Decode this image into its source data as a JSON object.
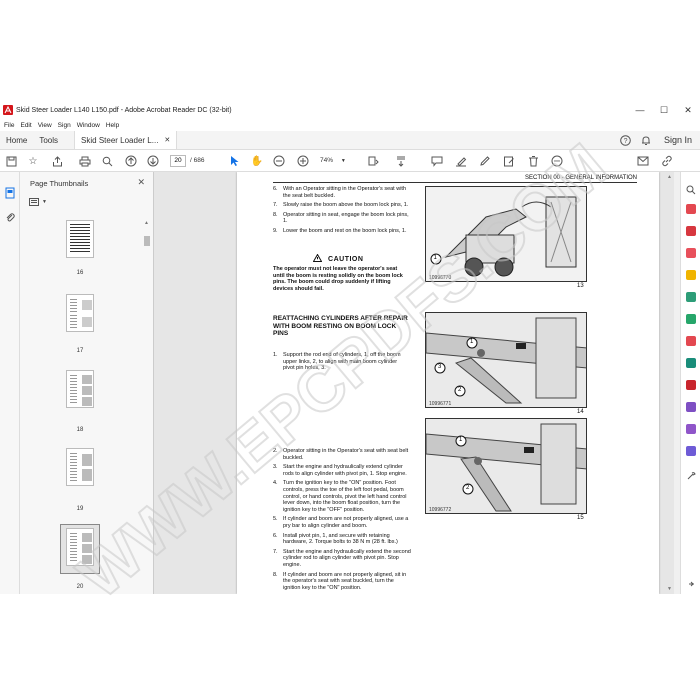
{
  "window": {
    "title": "Skid Steer Loader L140 L150.pdf - Adobe Acrobat Reader DC (32-bit)"
  },
  "menu": [
    "File",
    "Edit",
    "View",
    "Sign",
    "Window",
    "Help"
  ],
  "tabs": {
    "home": "Home",
    "tools": "Tools",
    "document": "Skid Steer Loader L...",
    "sign_in": "Sign In"
  },
  "toolbar": {
    "page_current": "20",
    "page_total": "/ 686",
    "zoom": "74%"
  },
  "panel": {
    "title": "Page Thumbnails",
    "thumbnails": [
      "16",
      "17",
      "18",
      "19",
      "20"
    ]
  },
  "document": {
    "section_header": "SECTION 00 - GENERAL INFORMATION",
    "steps_top": [
      {
        "n": "6.",
        "text": "With an Operator sitting in the Operator's seat with the seat belt buckled."
      },
      {
        "n": "7.",
        "text": "Slowly raise the boom above the boom lock pins, 1."
      },
      {
        "n": "8.",
        "text": "Operator sitting in seat, engage the boom lock pins, 1."
      },
      {
        "n": "9.",
        "text": "Lower the boom and rest on the boom lock pins, 1."
      }
    ],
    "caution_label": "CAUTION",
    "caution_text": "The operator must not leave the operator's seat until the boom is resting solidly on the boom lock pins. The boom could drop suddenly if lifting devices should fail.",
    "subheading": "REATTACHING CYLINDERS AFTER REPAIR WITH BOOM RESTING ON BOOM LOCK PINS",
    "steps_mid": [
      {
        "n": "1.",
        "text": "Support the rod end of cylinders, 1, off the boom upper links, 2, to align with main boom cylinder pivot pin holes, 3."
      }
    ],
    "steps_bottom": [
      {
        "n": "2.",
        "text": "Operator sitting in the Operator's seat with seat belt buckled."
      },
      {
        "n": "3.",
        "text": "Start the engine and hydraulically extend cylinder rods to align cylinder with pivot pin, 1. Stop engine."
      },
      {
        "n": "4.",
        "text": "Turn the ignition key to the \"ON\" position. Foot controls, press the toe of the left foot pedal, boom control, or hand controls, pivot the left hand control lever down, into the boom float position, turn the ignition key to the \"OFF\" position."
      },
      {
        "n": "5.",
        "text": "If cylinder and boom are not properly aligned, use a pry bar to align cylinder and boom."
      },
      {
        "n": "6.",
        "text": "Install pivot pin, 1, and secure with retaining hardware, 2. Torque bolts to 38 N m (28 ft. lbs.)"
      },
      {
        "n": "7.",
        "text": "Start the engine and hydraulically extend the second cylinder rod to align cylinder with pivot pin. Stop engine."
      },
      {
        "n": "8.",
        "text": "If cylinder and boom are not properly aligned, sit in the operator's seat with seat buckled, turn the ignition key to the \"ON\" position."
      }
    ],
    "figures": [
      {
        "caption": "10996770",
        "number": "13",
        "callouts": [
          "1"
        ]
      },
      {
        "caption": "10996771",
        "number": "14",
        "callouts": [
          "1",
          "2",
          "3"
        ]
      },
      {
        "caption": "10996772",
        "number": "15",
        "callouts": [
          "1",
          "2"
        ]
      }
    ]
  },
  "watermark": "WWW.EPCPDFS.COM"
}
